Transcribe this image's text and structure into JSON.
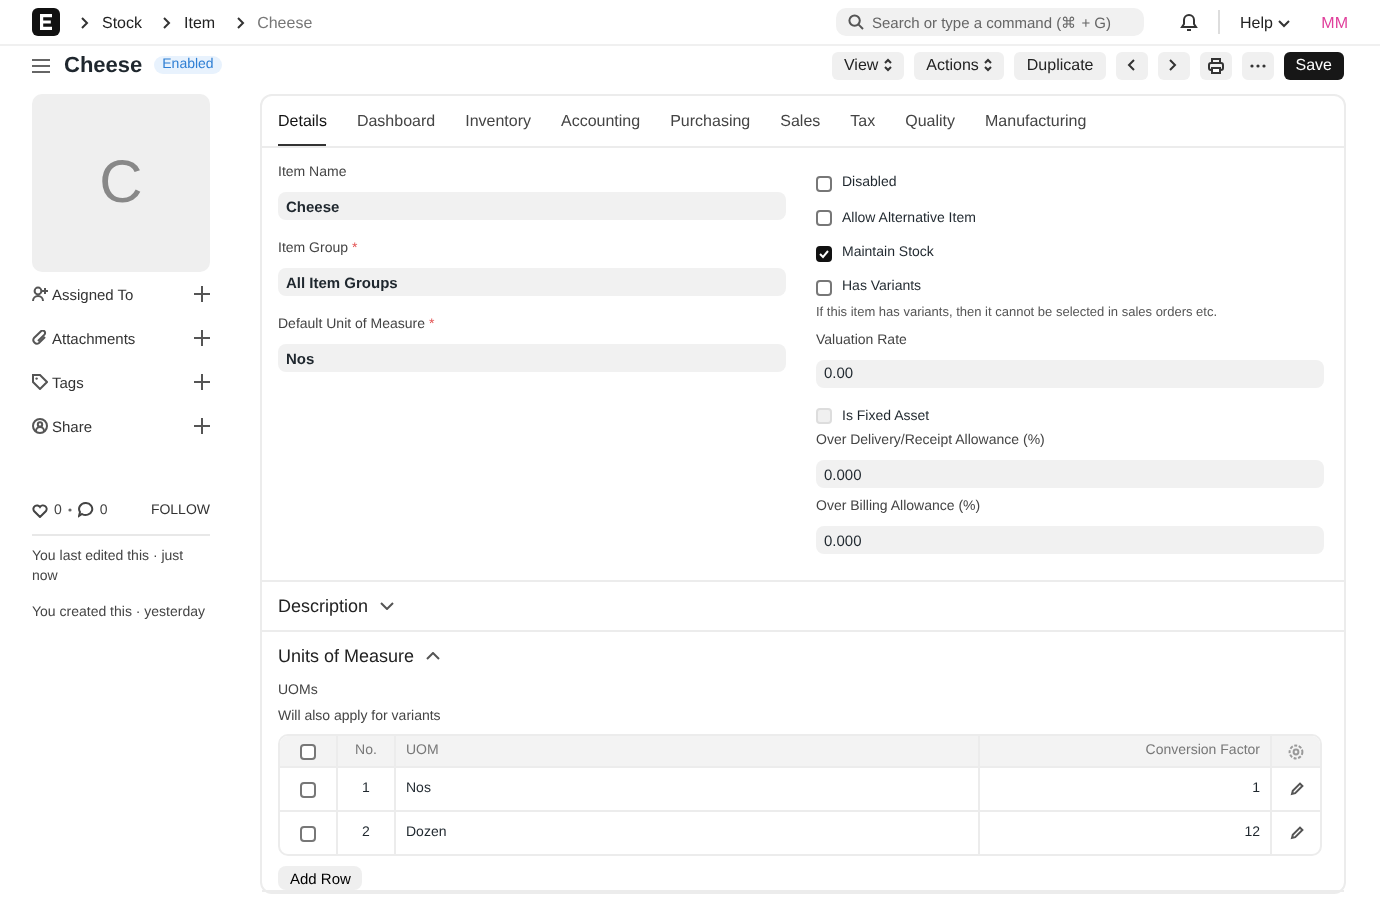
{
  "navbar": {
    "breadcrumbs": [
      {
        "label": "Stock",
        "current": false
      },
      {
        "label": "Item",
        "current": false
      },
      {
        "label": "Cheese",
        "current": true
      }
    ],
    "search": {
      "placeholder": "Search or type a command (⌘ + G)"
    },
    "help": "Help",
    "avatar": "MM"
  },
  "header": {
    "title": "Cheese",
    "status": "Enabled",
    "buttons": [
      {
        "kind": "dropdown",
        "label": "View"
      },
      {
        "kind": "dropdown",
        "label": "Actions"
      },
      {
        "kind": "plain",
        "label": "Duplicate"
      },
      {
        "kind": "prev"
      },
      {
        "kind": "next"
      },
      {
        "kind": "print"
      },
      {
        "kind": "more"
      },
      {
        "kind": "primary",
        "label": "Save"
      }
    ]
  },
  "sidebar": {
    "avatar_letter": "C",
    "actions": [
      {
        "kind": "assign",
        "label": "Assigned To"
      },
      {
        "kind": "attach",
        "label": "Attachments"
      },
      {
        "kind": "tag",
        "label": "Tags"
      },
      {
        "kind": "share",
        "label": "Share"
      }
    ],
    "likes": "0",
    "comments": "0",
    "follow": "FOLLOW",
    "activity": [
      "You last edited this · just now",
      "You created this · yesterday"
    ]
  },
  "tabs": [
    {
      "label": "Details",
      "selected": true
    },
    {
      "label": "Dashboard",
      "selected": false
    },
    {
      "label": "Inventory",
      "selected": false
    },
    {
      "label": "Accounting",
      "selected": false
    },
    {
      "label": "Purchasing",
      "selected": false
    },
    {
      "label": "Sales",
      "selected": false
    },
    {
      "label": "Tax",
      "selected": false
    },
    {
      "label": "Quality",
      "selected": false
    },
    {
      "label": "Manufacturing",
      "selected": false
    }
  ],
  "left_fields": [
    {
      "label": "Item Name",
      "value": "Cheese"
    },
    {
      "label": "Item Group",
      "required_mark": "*",
      "value": "All Item Groups"
    },
    {
      "label": "Default Unit of Measure",
      "required_mark": "*",
      "value": "Nos"
    }
  ],
  "right_fields": [
    {
      "kind": "checkbox",
      "label": "Disabled",
      "checked": false,
      "disabled": false
    },
    {
      "kind": "checkbox",
      "label": "Allow Alternative Item",
      "checked": false,
      "disabled": false
    },
    {
      "kind": "checkbox",
      "label": "Maintain Stock",
      "checked": true,
      "disabled": false
    },
    {
      "kind": "checkbox",
      "label": "Has Variants",
      "checked": false,
      "disabled": false
    },
    {
      "kind": "note",
      "label": "If this item has variants, then it cannot be selected in sales orders etc."
    },
    {
      "kind": "input",
      "label": "Valuation Rate",
      "value": "0.00"
    },
    {
      "kind": "checkbox",
      "label": "Is Fixed Asset",
      "checked": false,
      "disabled": true
    },
    {
      "kind": "input",
      "label": "Over Delivery/Receipt Allowance (%)",
      "value": "0.000"
    },
    {
      "kind": "input",
      "label": "Over Billing Allowance (%)",
      "value": "0.000"
    }
  ],
  "sections": [
    {
      "title": "Description",
      "expanded": false
    },
    {
      "title": "Units of Measure",
      "expanded": true
    }
  ],
  "uoms": {
    "label": "UOMs",
    "description": "Will also apply for variants",
    "header_checked": false,
    "columns": [
      "No.",
      "UOM",
      "Conversion Factor"
    ],
    "rows": [
      {
        "checked": false,
        "no": "1",
        "uom": "Nos",
        "factor": "1"
      },
      {
        "checked": false,
        "no": "2",
        "uom": "Dozen",
        "factor": "12"
      }
    ],
    "add_row": "Add Row"
  }
}
